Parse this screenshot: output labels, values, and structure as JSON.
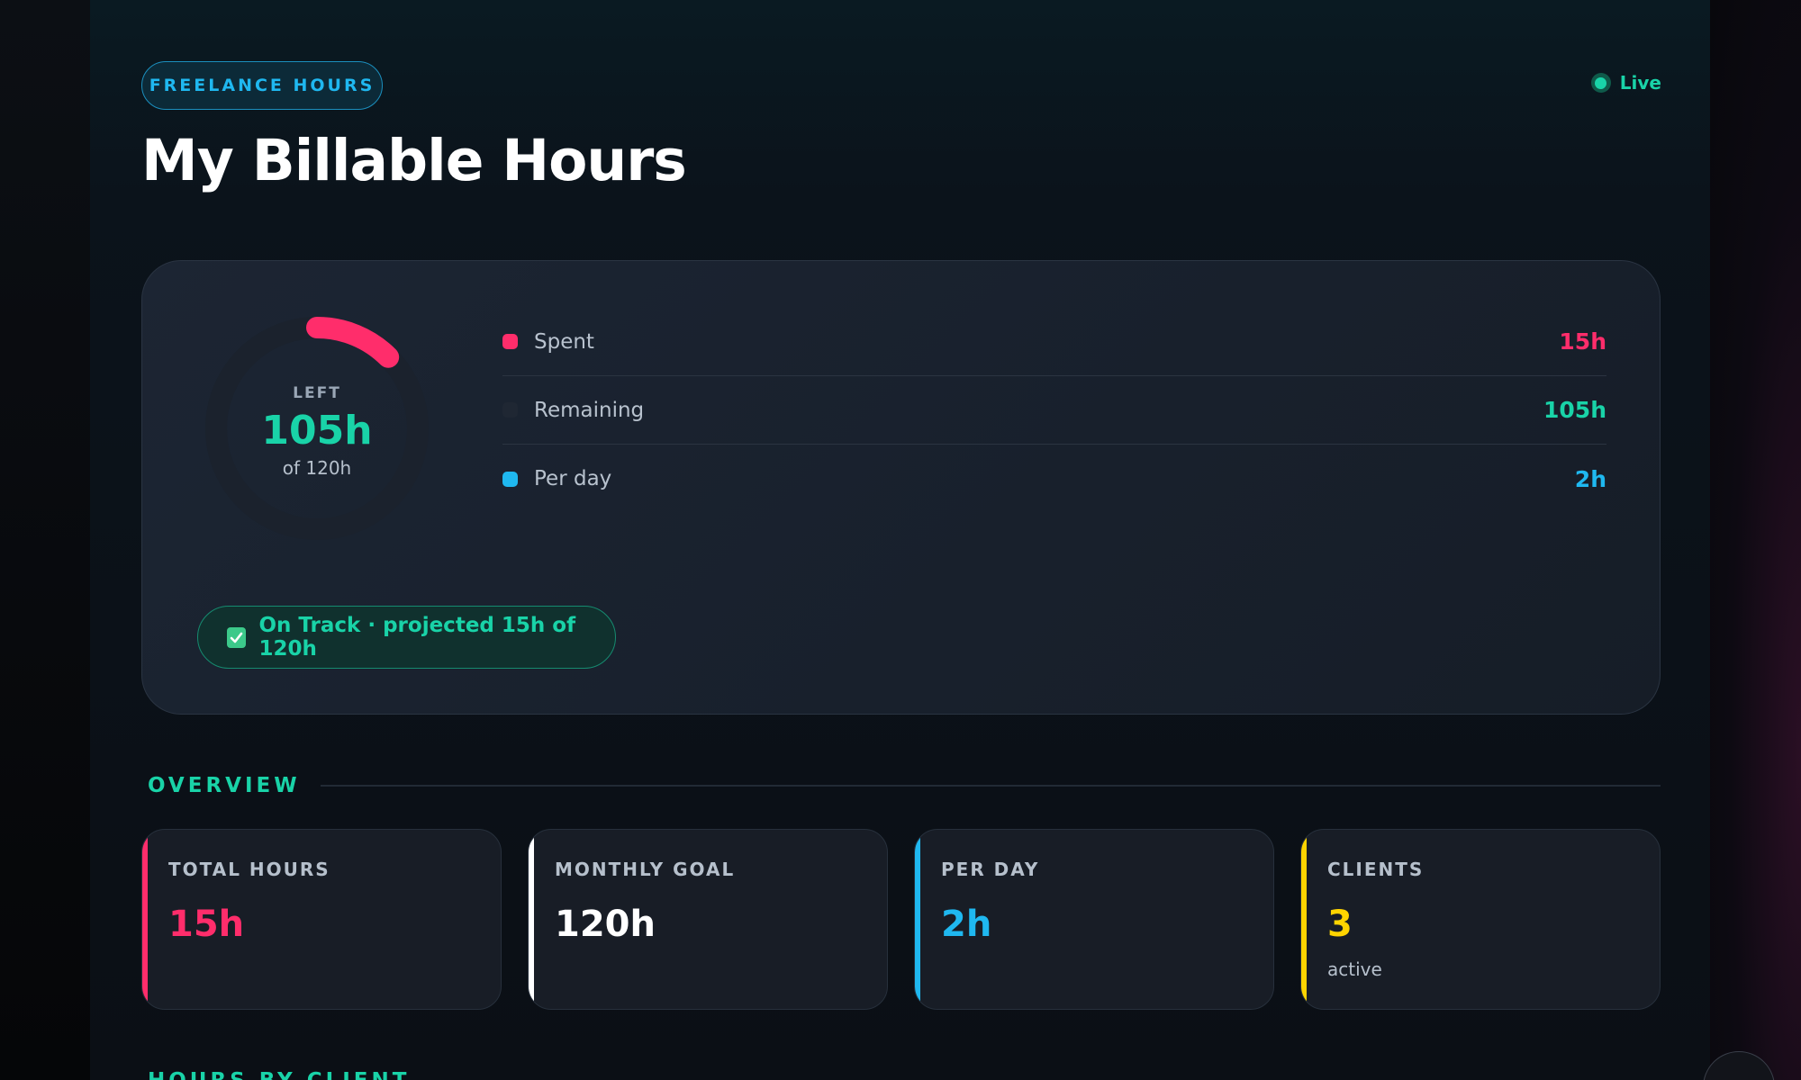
{
  "header": {
    "tag": "FREELANCE HOURS",
    "title": "My Billable Hours",
    "live_label": "Live"
  },
  "summary": {
    "ring_label": "LEFT",
    "ring_value": "105h",
    "ring_of": "of 120h",
    "spent_fraction": 0.125,
    "legend": [
      {
        "label": "Spent",
        "value": "15h",
        "color": "#ff2d6b"
      },
      {
        "label": "Remaining",
        "value": "105h",
        "color": "#19d3a8",
        "swatch": "#1f2733"
      },
      {
        "label": "Per day",
        "value": "2h",
        "color": "#1fb8f0"
      }
    ],
    "status": "On Track · projected 15h of 120h"
  },
  "overview": {
    "title": "OVERVIEW",
    "stats": [
      {
        "label": "TOTAL HOURS",
        "value": "15h",
        "color": "#ff2d6b"
      },
      {
        "label": "MONTHLY GOAL",
        "value": "120h",
        "color": "#ffffff"
      },
      {
        "label": "PER DAY",
        "value": "2h",
        "color": "#1fb8f0"
      },
      {
        "label": "CLIENTS",
        "value": "3",
        "sub": "active",
        "color": "#ffd400"
      }
    ]
  },
  "next_section": {
    "title": "HOURS BY CLIENT"
  }
}
